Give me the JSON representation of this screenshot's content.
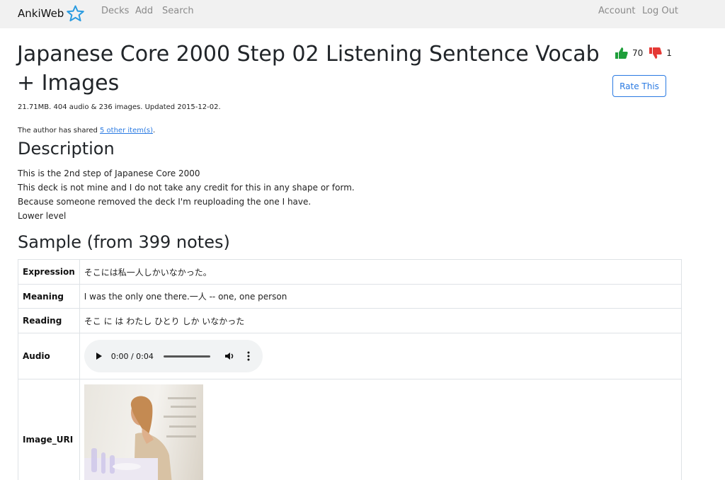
{
  "nav": {
    "brand": "AnkiWeb",
    "links": [
      "Decks",
      "Add",
      "Search"
    ],
    "account": "Account",
    "logout": "Log Out"
  },
  "deck": {
    "title": "Japanese Core 2000 Step 02 Listening Sentence Vocab + Images",
    "likes": "70",
    "dislikes": "1",
    "rate_button": "Rate This",
    "meta": "21.71MB. 404 audio & 236 images. Updated 2015-12-02.",
    "shared_prefix": "The author has shared ",
    "shared_link": "5 other item(s)",
    "shared_suffix": "."
  },
  "description": {
    "heading": "Description",
    "lines": [
      "This is the 2nd step of Japanese Core 2000",
      "This deck is not mine and I do not take any credit for this in any shape or form.",
      "Because someone removed the deck I'm reuploading the one I have.",
      "Lower level"
    ]
  },
  "sample": {
    "heading": "Sample (from 399 notes)",
    "rows": [
      {
        "field": "Expression",
        "value": "そこには私一人しかいなかった。"
      },
      {
        "field": "Meaning",
        "value": "I was the only one there.一人 -- one, one person"
      },
      {
        "field": "Reading",
        "value": "そこ に は わたし ひとり しか いなかった"
      },
      {
        "field": "Audio",
        "value": ""
      },
      {
        "field": "Image_URI",
        "value": ""
      }
    ],
    "audio_time": "0:00 / 0:04"
  },
  "colors": {
    "link": "#2a7ae2",
    "thumbs_up": "#1e9e3a",
    "thumbs_down": "#e53935"
  }
}
